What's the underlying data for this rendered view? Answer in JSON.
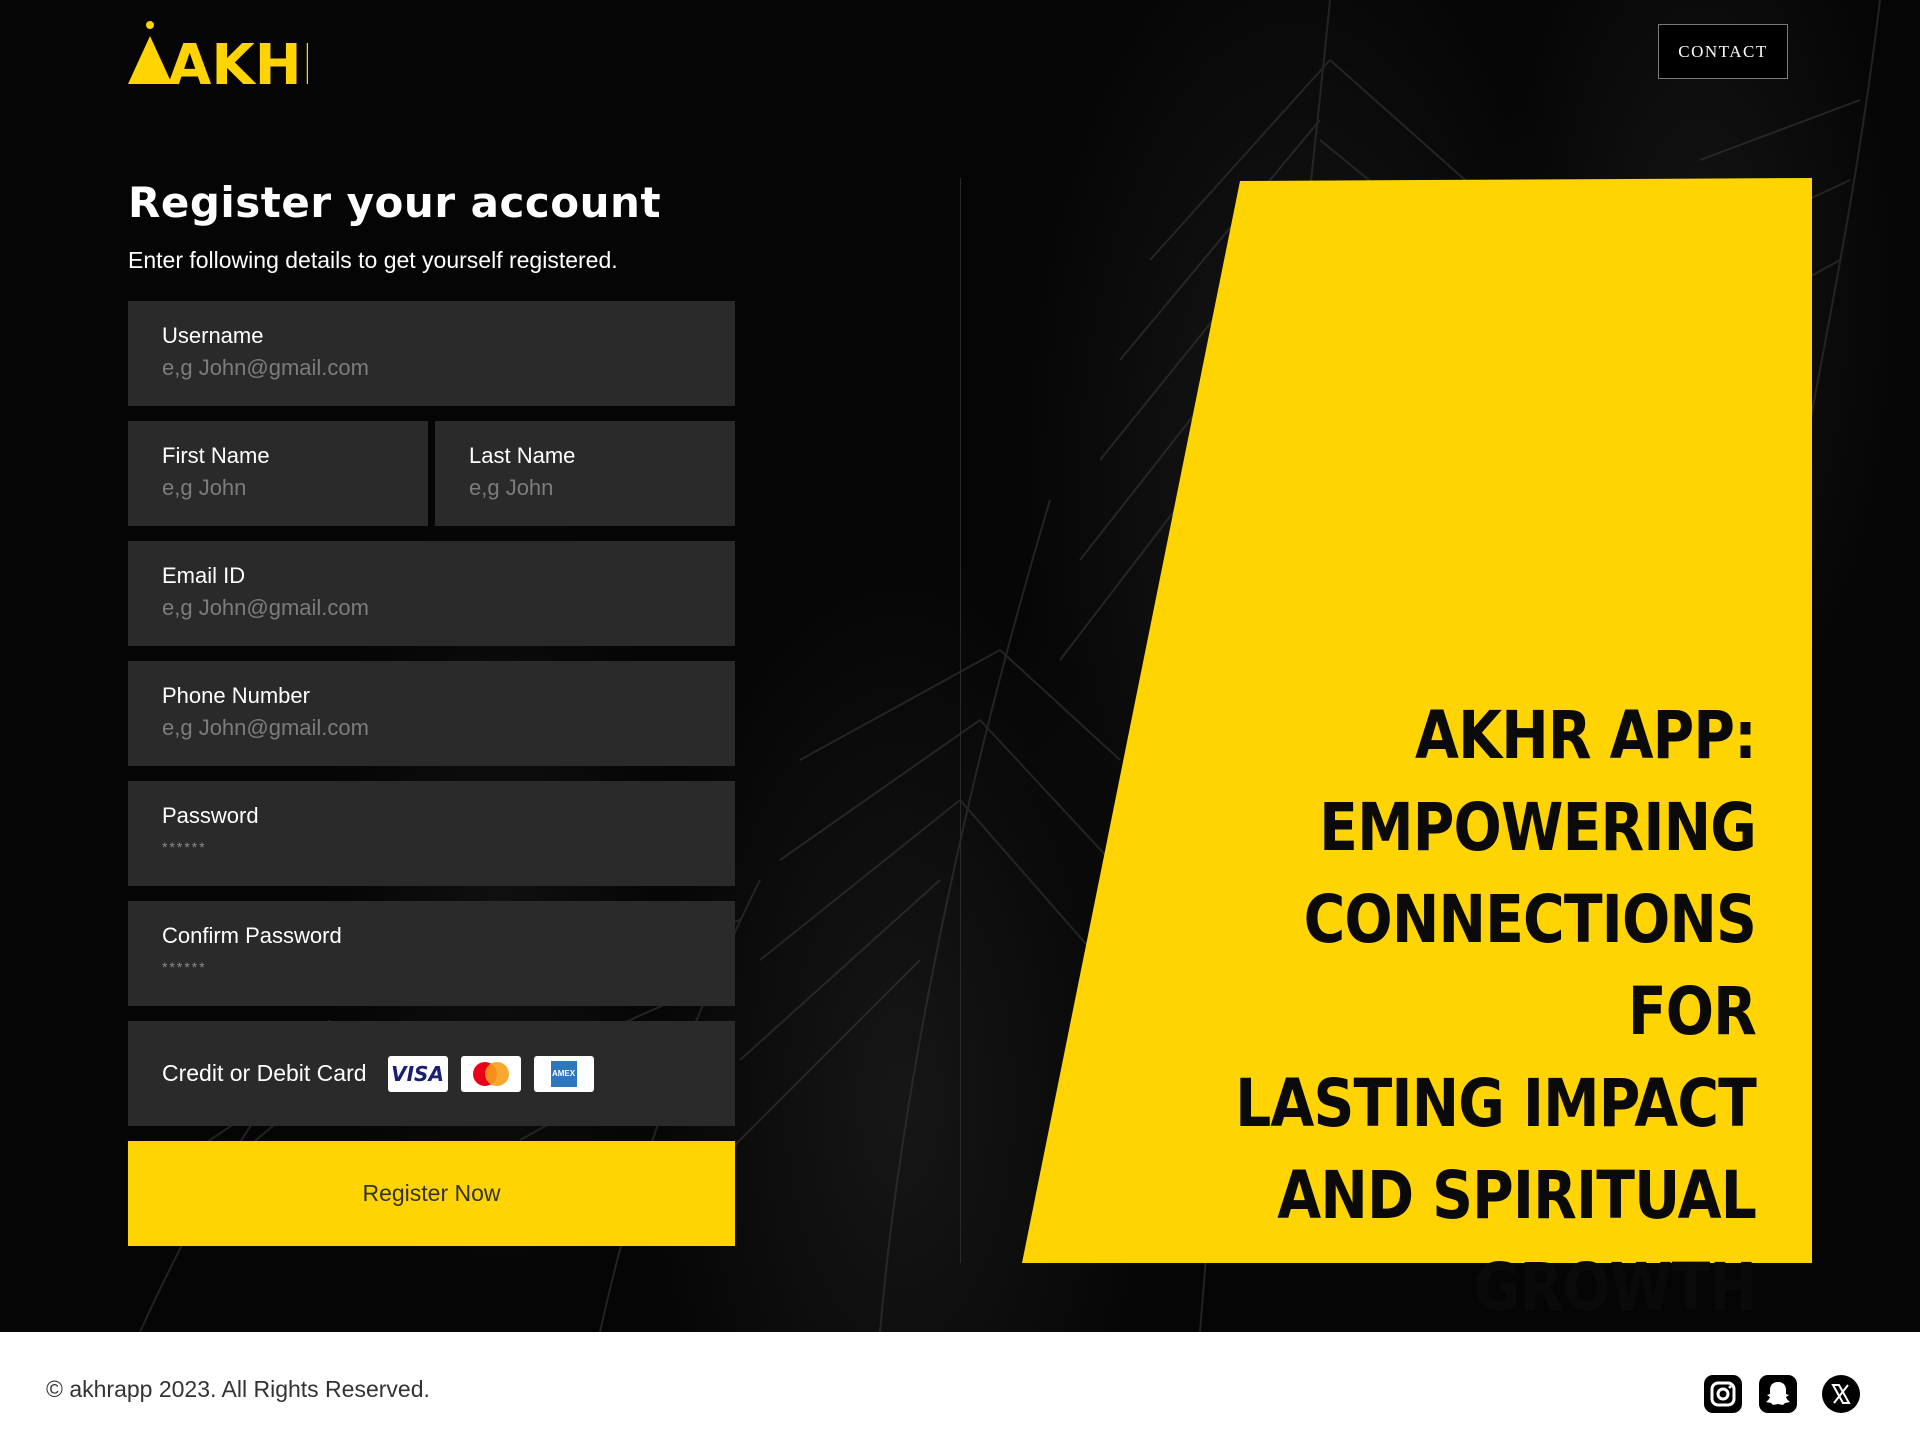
{
  "header": {
    "logo_text": "AKHR",
    "contact_label": "CONTACT"
  },
  "form": {
    "title": "Register your account",
    "subtitle": "Enter following details to get yourself registered.",
    "fields": {
      "username": {
        "label": "Username",
        "placeholder": "e,g John@gmail.com"
      },
      "first_name": {
        "label": "First Name",
        "placeholder": "e,g John"
      },
      "last_name": {
        "label": "Last Name",
        "placeholder": "e,g John"
      },
      "email": {
        "label": "Email ID",
        "placeholder": "e,g John@gmail.com"
      },
      "phone": {
        "label": "Phone Number",
        "placeholder": "e,g John@gmail.com"
      },
      "password": {
        "label": "Password",
        "placeholder": "******"
      },
      "confirm_password": {
        "label": "Confirm Password",
        "placeholder": "******"
      }
    },
    "card": {
      "label": "Credit or Debit Card",
      "logos": [
        "visa-icon",
        "mastercard-icon",
        "amex-icon"
      ],
      "visa_text": "VISA",
      "amex_text": "AMEX"
    },
    "submit_label": "Register Now"
  },
  "promo": {
    "headline_lines": [
      "AKHR APP:",
      "EMPOWERING",
      "CONNECTIONS FOR",
      "LASTING IMPACT",
      "AND SPIRITUAL",
      "GROWTH"
    ]
  },
  "footer": {
    "copyright": "© akhrapp 2023. All Rights Reserved.",
    "social_icons": [
      "instagram-icon",
      "snapchat-icon",
      "x-icon"
    ]
  },
  "colors": {
    "accent": "#ffd400",
    "background": "#050505",
    "field_bg": "#2a2a2a"
  }
}
